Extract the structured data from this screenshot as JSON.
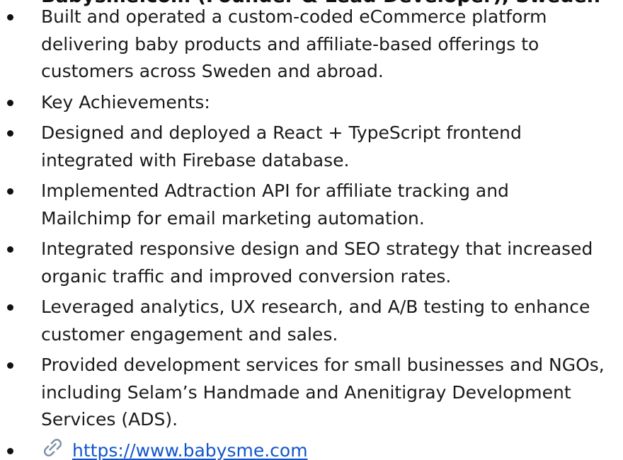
{
  "heading_fragment": "Babysme.com (Founder & Lead Developer), Sweden",
  "bullets": [
    {
      "line1": "Built and operated a custom-coded eCommerce platform",
      "line2": "delivering baby products and affiliate-based offerings to",
      "line3": "customers across Sweden and abroad."
    },
    {
      "line1": "Key Achievements:"
    },
    {
      "line1": "Designed and deployed a React + TypeScript frontend",
      "line2": "integrated with Firebase database."
    },
    {
      "line1": "Implemented Adtraction API for affiliate tracking and",
      "line2": "Mailchimp for email marketing automation."
    },
    {
      "line1": "Integrated responsive design and SEO strategy that increased",
      "line2": "organic traffic and improved conversion rates."
    },
    {
      "line1": "Leveraged analytics, UX research, and A/B testing to enhance",
      "line2": "customer engagement and sales."
    },
    {
      "line1": "Provided development services for small businesses and NGOs,",
      "line2": "including Selam’s Handmade and Anenitigray Development",
      "line3": "Services (ADS)."
    }
  ],
  "link": {
    "icon": "link-icon",
    "text": "https://www.babysme.com"
  },
  "colors": {
    "link": "#1155cc",
    "text": "#1a1a1a",
    "background": "#ffffff"
  }
}
